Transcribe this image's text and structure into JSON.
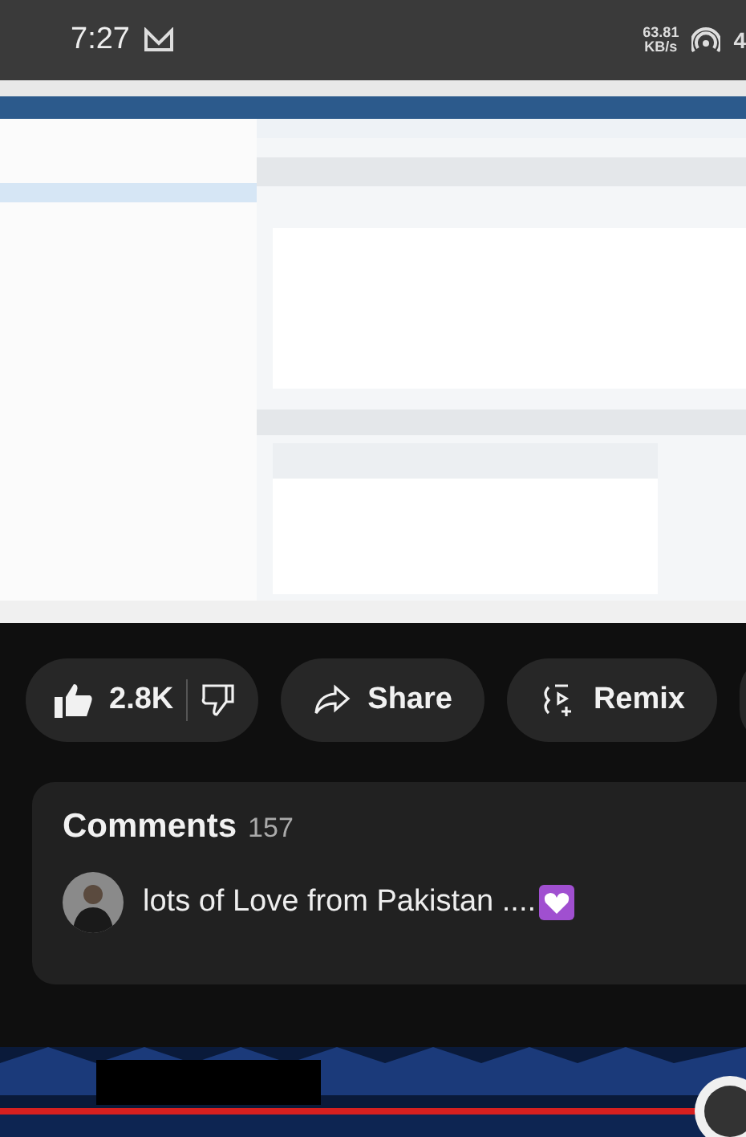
{
  "status_bar": {
    "time": "7:27",
    "speed_value": "63.81",
    "speed_unit": "KB/s",
    "network": "4"
  },
  "actions": {
    "likes": "2.8K",
    "buttons": [
      {
        "kind": "share",
        "label": "Share"
      },
      {
        "kind": "remix",
        "label": "Remix"
      }
    ]
  },
  "comments": {
    "title": "Comments",
    "count": "157",
    "top_comment": "lots of Love from Pakistan ...."
  }
}
